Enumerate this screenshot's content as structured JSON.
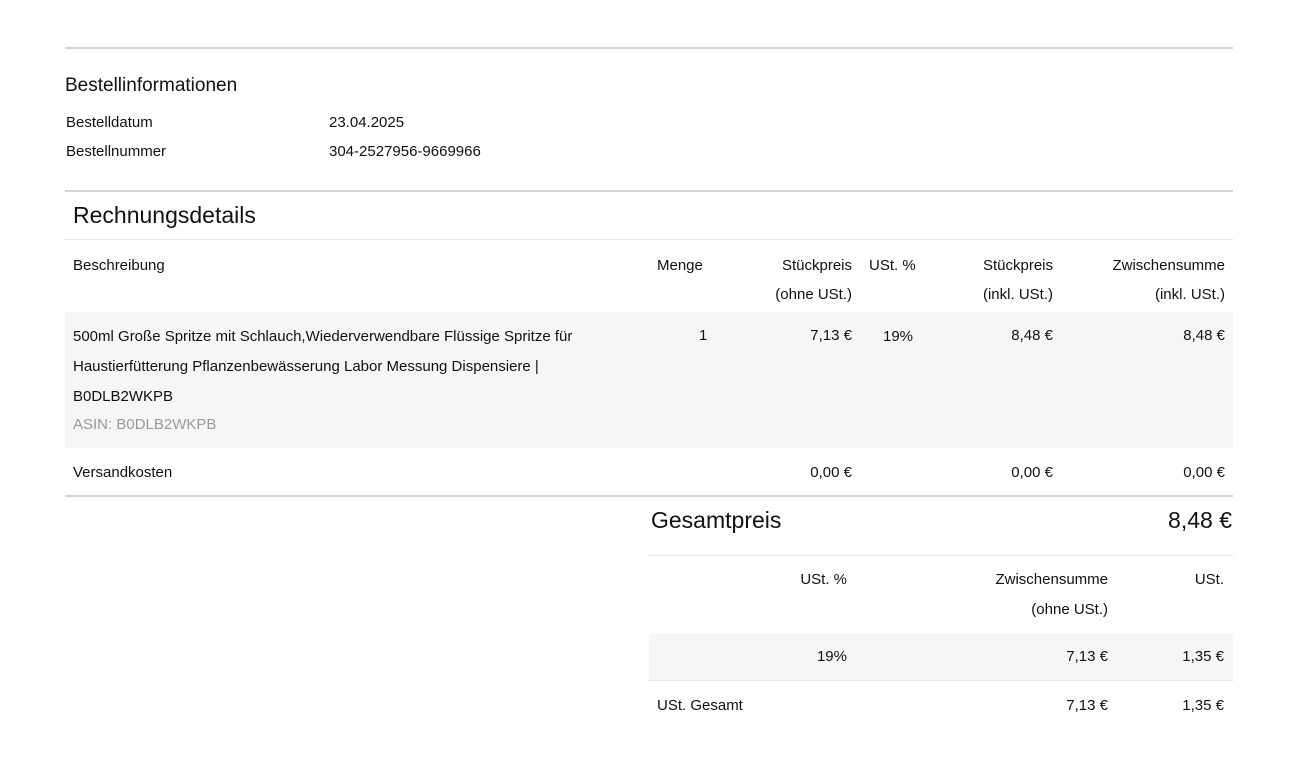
{
  "order_info": {
    "heading": "Bestellinformationen",
    "date_label": "Bestelldatum",
    "date_value": "23.04.2025",
    "number_label": "Bestellnummer",
    "number_value": "304-2527956-9669966"
  },
  "invoice": {
    "heading": "Rechnungsdetails",
    "columns": {
      "description": "Beschreibung",
      "quantity": "Menge",
      "unit_price_net_1": "Stückpreis",
      "unit_price_net_2": "(ohne USt.)",
      "vat": "USt. %",
      "unit_price_gross_1": "Stückpreis",
      "unit_price_gross_2": "(inkl. USt.)",
      "subtotal_1": "Zwischensumme",
      "subtotal_2": "(inkl. USt.)"
    },
    "item": {
      "description": "500ml Große Spritze mit Schlauch,Wiederverwendbare Flüssige Spritze für Haustierfütterung Pflanzenbewässerung Labor Messung Dispensiere | B0DLB2WKPB",
      "asin": "ASIN: B0DLB2WKPB",
      "quantity": "1",
      "unit_price_net": "7,13 €",
      "vat": "19%",
      "unit_price_gross": "8,48 €",
      "subtotal": "8,48 €"
    },
    "shipping": {
      "label": "Versandkosten",
      "unit_price_net": "0,00 €",
      "unit_price_gross": "0,00 €",
      "subtotal": "0,00 €"
    },
    "total": {
      "label": "Gesamtpreis",
      "value": "8,48 €"
    }
  },
  "vat_summary": {
    "columns": {
      "vat": "USt. %",
      "subtotal_1": "Zwischensumme",
      "subtotal_2": "(ohne USt.)",
      "tax": "USt."
    },
    "row": {
      "vat": "19%",
      "subtotal": "7,13 €",
      "tax": "1,35 €"
    },
    "total": {
      "label": "USt. Gesamt",
      "subtotal": "7,13 €",
      "tax": "1,35 €"
    }
  }
}
